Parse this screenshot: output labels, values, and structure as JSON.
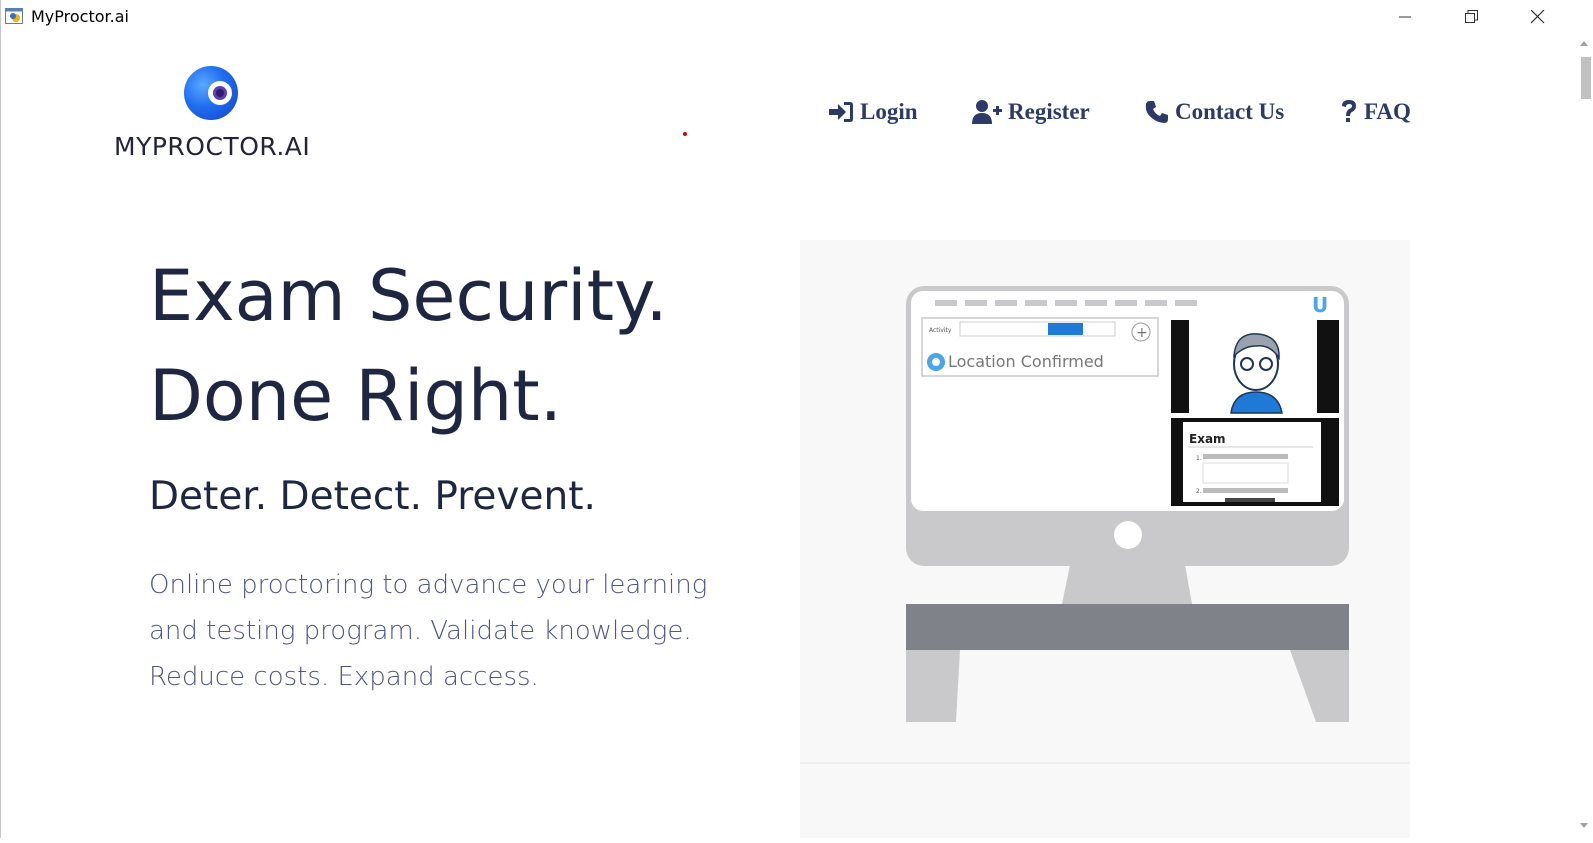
{
  "window": {
    "title": "MyProctor.ai",
    "controls": {
      "minimize": "minimize-icon",
      "restore": "restore-icon",
      "close": "close-icon"
    }
  },
  "brand": {
    "logo_text": "MYPROCTOR.AI"
  },
  "nav": {
    "items": [
      {
        "label": "Login",
        "icon": "sign-in-icon"
      },
      {
        "label": "Register",
        "icon": "user-plus-icon"
      },
      {
        "label": "Contact Us",
        "icon": "phone-icon"
      },
      {
        "label": "FAQ",
        "icon": "question-icon"
      }
    ]
  },
  "hero": {
    "title_line1": "Exam Security.",
    "title_line2": "Done Right.",
    "subtitle": "Deter. Detect. Prevent.",
    "description": "Online proctoring to advance your learning and testing program. Validate knowledge. Reduce costs. Expand access."
  },
  "illustration": {
    "tabs": [
      "Activity"
    ],
    "status": "Location Confirmed",
    "exam_label": "Exam",
    "question_numbers": [
      "1.",
      "2."
    ]
  },
  "colors": {
    "nav_text": "#2b3a67",
    "heading": "#1f2641",
    "body_text": "#4f5585",
    "accent_blue": "#1f6df0"
  }
}
